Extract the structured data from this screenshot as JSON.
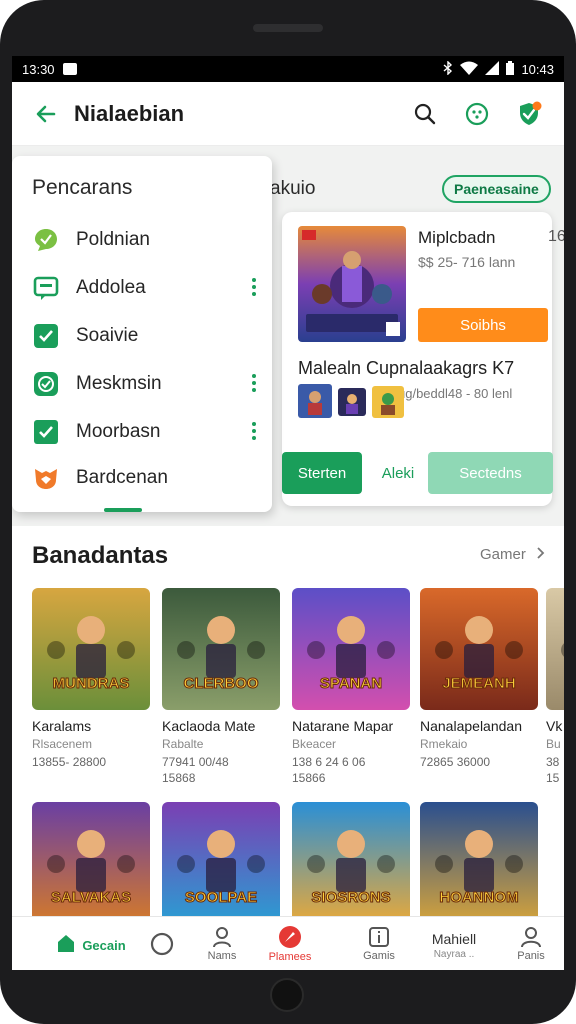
{
  "status_bar": {
    "time": "13:30",
    "right_time": "10:43"
  },
  "app_bar": {
    "title": "Nialaebian"
  },
  "drawer": {
    "title": "Pencarans",
    "items": [
      {
        "label": "Poldnian",
        "icon": "chat-bubble-icon",
        "more": false
      },
      {
        "label": "Addolea",
        "icon": "message-square-icon",
        "more": true
      },
      {
        "label": "Soaivie",
        "icon": "check-box-icon",
        "more": false
      },
      {
        "label": "Meskmsin",
        "icon": "check-circle-icon",
        "more": true
      },
      {
        "label": "Moorbasn",
        "icon": "check-box-icon",
        "more": true
      },
      {
        "label": "Bardcenan",
        "icon": "fox-badge-icon",
        "more": false
      }
    ]
  },
  "content": {
    "category_partial": "akuio",
    "badge": "Paeneasaine"
  },
  "featured": {
    "name": "Miplcbadn",
    "count": "16",
    "meta": "$$ 25- 716 lann",
    "install_label": "Soibhs",
    "subtitle": "Malealn Cupnalaakagrs K7",
    "submeta": "Nlsaug/beddl48 - 80 lenl",
    "art_title": "THE QOMES KRATOS"
  },
  "action_pills": {
    "start": "Sterten",
    "mid": "Aleki",
    "secondary": "Sectedns"
  },
  "section": {
    "title": "Banadantas",
    "see_more": "Gamer",
    "games": [
      {
        "name": "Karalams",
        "sub": "Rlsacenem",
        "stat": "13855- 28800",
        "stat2": "",
        "art_text": "MUNDRAS",
        "palette": [
          "#d7a640",
          "#6b8f3a"
        ]
      },
      {
        "name": "Kaclaoda Mate",
        "sub": "Rabalte",
        "stat": "77941 00/48",
        "stat2": "15868",
        "art_text": "CLERBOO",
        "palette": [
          "#3c5a3c",
          "#8a9e6a"
        ]
      },
      {
        "name": "Natarane Mapar",
        "sub": "Bkeacer",
        "stat": "138 6 24 6 06",
        "stat2": "15866",
        "art_text": "SPANAN",
        "palette": [
          "#5c4fc7",
          "#d34fae"
        ]
      },
      {
        "name": "Nanalapelandan",
        "sub": "Rmekaio",
        "stat": "72865 36000",
        "stat2": "",
        "art_text": "JEMEANH",
        "palette": [
          "#d9692a",
          "#7a2a1a"
        ]
      },
      {
        "name": "Vk",
        "sub": "Bu",
        "stat": "38",
        "stat2": "15",
        "art_text": "",
        "palette": [
          "#d9c9a6",
          "#9a8a6a"
        ]
      },
      {
        "name": "",
        "sub": "",
        "stat": "",
        "stat2": "",
        "art_text": "SALVAKAS",
        "palette": [
          "#6a3fa3",
          "#d47a2a"
        ]
      },
      {
        "name": "",
        "sub": "",
        "stat": "",
        "stat2": "",
        "art_text": "SOOLPAE",
        "palette": [
          "#7b3fb3",
          "#2a9ed3"
        ]
      },
      {
        "name": "",
        "sub": "",
        "stat": "",
        "stat2": "",
        "art_text": "SIOSRONS",
        "palette": [
          "#2a8fd6",
          "#e8a93a"
        ]
      },
      {
        "name": "",
        "sub": "",
        "stat": "",
        "stat2": "",
        "art_text": "HOANNOM",
        "palette": [
          "#2a4f8f",
          "#d6a43a"
        ]
      }
    ]
  },
  "bottom_nav": {
    "items": [
      {
        "label": "Gecain",
        "icon": "home-icon"
      },
      {
        "label": "",
        "icon": "circle-icon"
      },
      {
        "label": "Nams",
        "icon": "person-icon"
      },
      {
        "label": "Plamees",
        "icon": "compass-icon"
      },
      {
        "label": "Gamis",
        "icon": "info-icon"
      },
      {
        "label": "Mahiell",
        "sub": "Nayraa ..",
        "icon": ""
      },
      {
        "label": "Panis",
        "icon": "account-icon"
      }
    ]
  },
  "colors": {
    "accent": "#1a9e5a",
    "orange": "#ff8c1a",
    "light_green": "#8fd8b5",
    "red": "#e53935"
  }
}
